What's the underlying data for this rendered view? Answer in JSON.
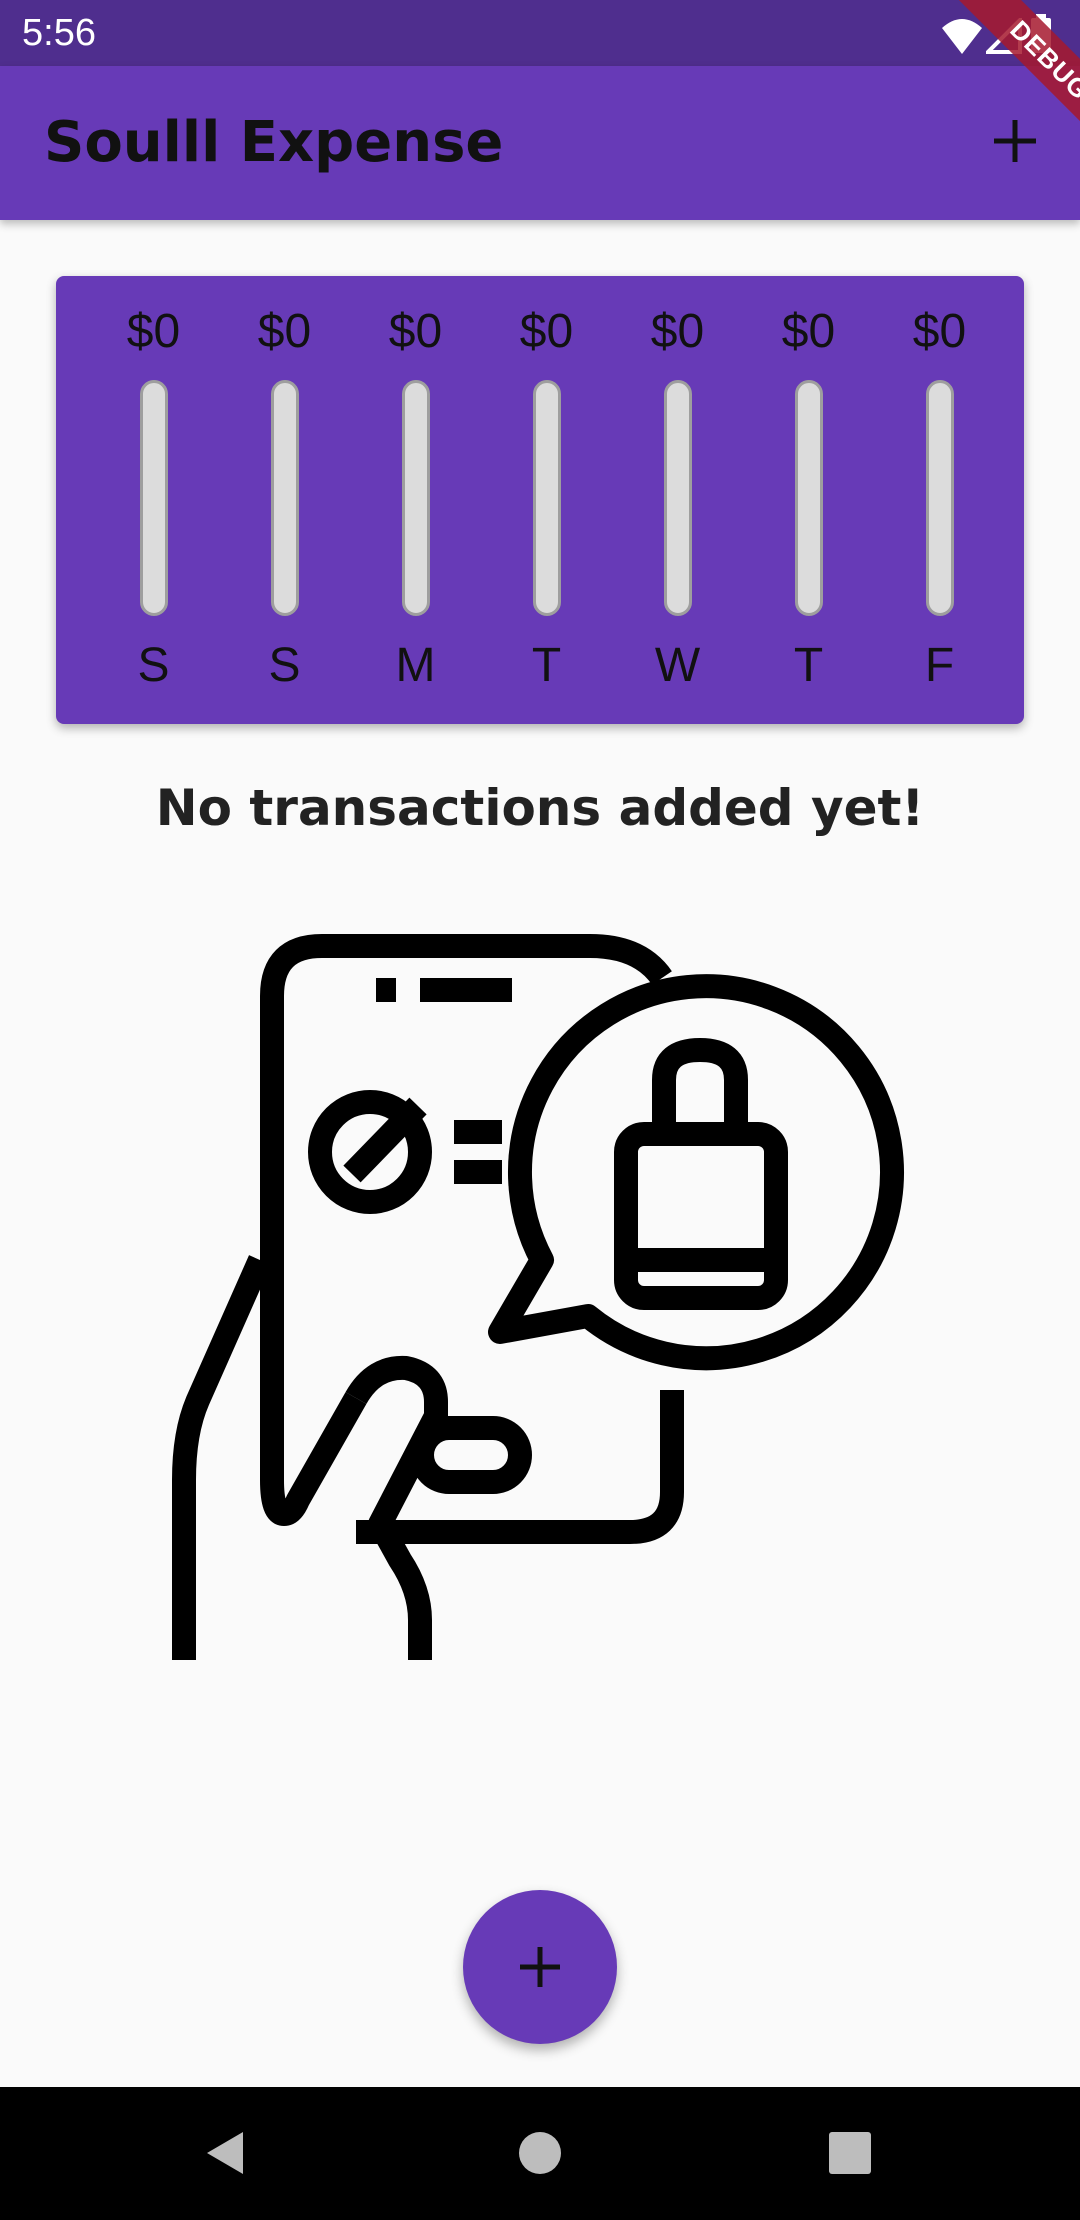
{
  "status_bar": {
    "time": "5:56",
    "icons": [
      "wifi-icon",
      "cell-signal-icon",
      "battery-icon"
    ]
  },
  "debug_banner": {
    "label": "DEBUG"
  },
  "app_bar": {
    "title": "Soulll Expense",
    "action_icon": "plus-icon"
  },
  "chart": {
    "days": [
      {
        "day": "S",
        "amount": "$0",
        "fill": 0
      },
      {
        "day": "S",
        "amount": "$0",
        "fill": 0
      },
      {
        "day": "M",
        "amount": "$0",
        "fill": 0
      },
      {
        "day": "T",
        "amount": "$0",
        "fill": 0
      },
      {
        "day": "W",
        "amount": "$0",
        "fill": 0
      },
      {
        "day": "T",
        "amount": "$0",
        "fill": 0
      },
      {
        "day": "F",
        "amount": "$0",
        "fill": 0
      }
    ]
  },
  "empty_state": {
    "message": "No transactions added yet!",
    "image_icon": "phone-shopping-bag-illustration"
  },
  "fab": {
    "icon": "plus-icon"
  },
  "nav_bar": {
    "icons": [
      "back-icon",
      "home-icon",
      "recents-icon"
    ]
  },
  "colors": {
    "primary": "#673ab7",
    "status_bar": "#4f2e8e",
    "bar_track": "#dcdcdc",
    "debug": "#a6192e"
  }
}
